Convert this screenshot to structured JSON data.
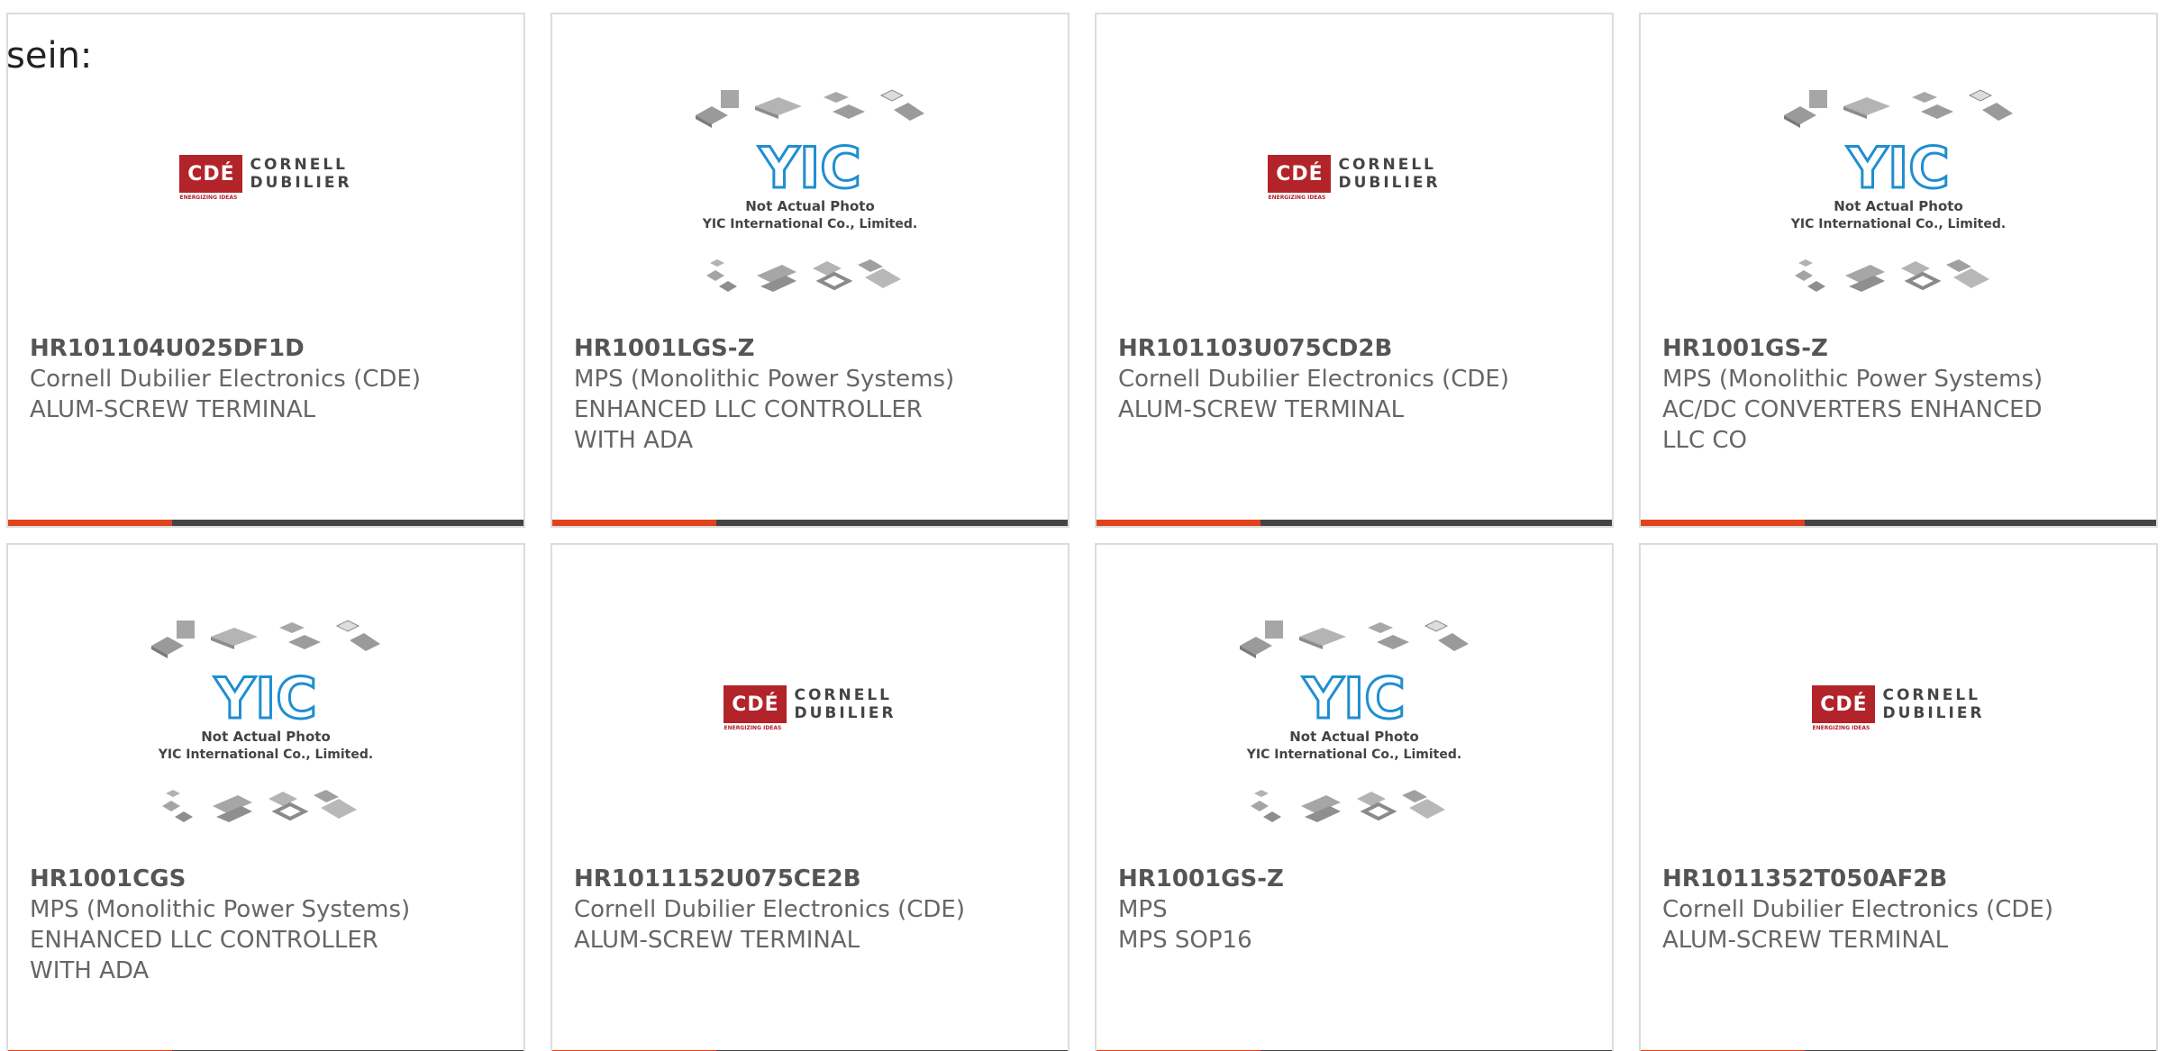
{
  "intro_text": "sein:",
  "colors": {
    "accent_bar": "#e0431c",
    "base_bar": "#444444",
    "cde_red": "#b3232a",
    "yic_blue": "#1f8ed1"
  },
  "logos": {
    "cde": {
      "badge": "CDÉ",
      "line1": "CORNELL",
      "line2": "DUBILIER",
      "tagline": "ENERGIZING IDEAS"
    },
    "yic": {
      "mark": "YIC",
      "line1": "Not Actual Photo",
      "line2": "YIC International Co., Limited."
    }
  },
  "products": [
    {
      "part_number": "HR101104U025DF1D",
      "manufacturer": "Cornell Dubilier Electronics (CDE)",
      "desc_line1": "ALUM-SCREW TERMINAL",
      "desc_line2": "",
      "image": "cde-logo"
    },
    {
      "part_number": "HR1001LGS-Z",
      "manufacturer": "MPS (Monolithic Power Systems)",
      "desc_line1": "ENHANCED LLC CONTROLLER",
      "desc_line2": "WITH ADA",
      "image": "yic-placeholder"
    },
    {
      "part_number": "HR101103U075CD2B",
      "manufacturer": "Cornell Dubilier Electronics (CDE)",
      "desc_line1": "ALUM-SCREW TERMINAL",
      "desc_line2": "",
      "image": "cde-logo"
    },
    {
      "part_number": "HR1001GS-Z",
      "manufacturer": "MPS (Monolithic Power Systems)",
      "desc_line1": "AC/DC CONVERTERS ENHANCED",
      "desc_line2": "LLC CO",
      "image": "yic-placeholder"
    },
    {
      "part_number": "HR1001CGS",
      "manufacturer": "MPS (Monolithic Power Systems)",
      "desc_line1": "ENHANCED LLC CONTROLLER",
      "desc_line2": "WITH ADA",
      "image": "yic-placeholder"
    },
    {
      "part_number": "HR1011152U075CE2B",
      "manufacturer": "Cornell Dubilier Electronics (CDE)",
      "desc_line1": "ALUM-SCREW TERMINAL",
      "desc_line2": "",
      "image": "cde-logo"
    },
    {
      "part_number": "HR1001GS-Z",
      "manufacturer": "MPS",
      "desc_line1": "MPS SOP16",
      "desc_line2": "",
      "image": "yic-placeholder"
    },
    {
      "part_number": "HR1011352T050AF2B",
      "manufacturer": "Cornell Dubilier Electronics (CDE)",
      "desc_line1": "ALUM-SCREW TERMINAL",
      "desc_line2": "",
      "image": "cde-logo"
    }
  ]
}
